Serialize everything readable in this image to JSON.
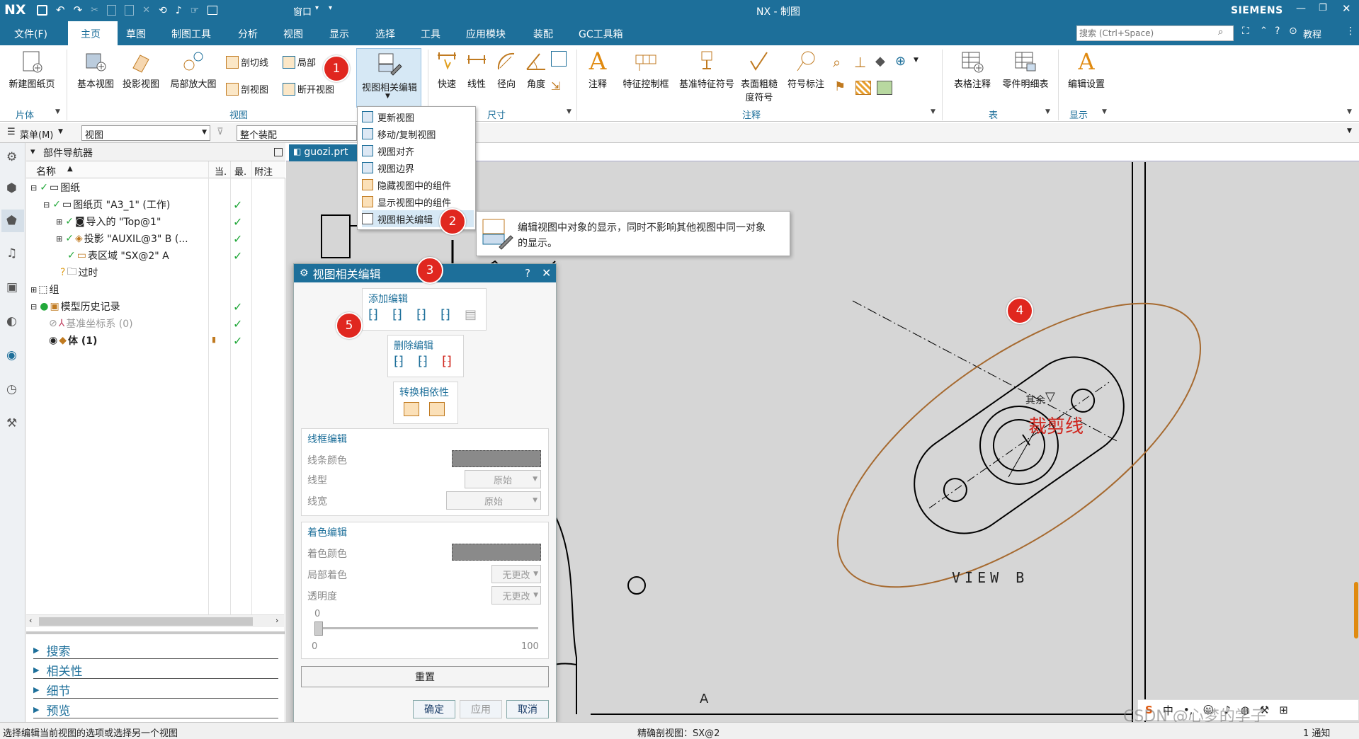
{
  "titlebar": {
    "logo": "NX",
    "title": "NX - 制图",
    "brand": "SIEMENS",
    "window_menu": "窗口",
    "quick_icons": [
      "save-icon",
      "undo-icon",
      "redo-icon",
      "cut-icon",
      "copy-icon",
      "paste-icon",
      "delete-icon",
      "repeat-icon",
      "microphone-icon",
      "touch-mode-icon",
      "switch-window-icon"
    ]
  },
  "menubar": {
    "file": "文件(F)",
    "tabs": [
      "主页",
      "草图",
      "制图工具",
      "分析",
      "视图",
      "显示",
      "选择",
      "工具",
      "应用模块",
      "装配",
      "GC工具箱"
    ],
    "active_tab": "主页",
    "search_placeholder": "搜索 (Ctrl+Space)",
    "tutorial": "教程"
  },
  "ribbon": {
    "new_sheet": "新建图纸页",
    "group_sheet": "片体",
    "base_view": "基本视图",
    "projected_view": "投影视图",
    "detail_view": "局部放大图",
    "section_line": "剖切线",
    "section_view": "剖视图",
    "local": "局部",
    "break_view": "断开视图",
    "view_dep_edit": "视图相关编辑",
    "group_view": "视图",
    "rapid": "快速",
    "linear": "线性",
    "radial": "径向",
    "angular": "角度",
    "group_dim": "尺寸",
    "note": "注释",
    "fcf": "特征控制框",
    "datum_symbol": "基准特征符号",
    "surface_finish_1": "表面粗糙",
    "surface_finish_2": "度符号",
    "id_symbol": "符号标注",
    "group_annotation": "注释",
    "tabular_note": "表格注释",
    "parts_list": "零件明细表",
    "group_table": "表",
    "edit_settings": "编辑设置",
    "group_display": "显示"
  },
  "selbar": {
    "menu": "菜单(M)",
    "filter": "视图",
    "scope": "整个装配"
  },
  "popup_menu": {
    "items": [
      "更新视图",
      "移动/复制视图",
      "视图对齐",
      "视图边界",
      "隐藏视图中的组件",
      "显示视图中的组件",
      "视图相关编辑"
    ]
  },
  "tooltip": {
    "line1": "编辑视图中对象的显示，同时不影响其他视图中同一对象",
    "line2": "的显示。"
  },
  "navigator": {
    "title": "部件导航器",
    "col_name": "名称",
    "col_current": "当.",
    "col_latest": "最.",
    "col_note": "附注",
    "rows": [
      {
        "label": "图纸",
        "check": "✓"
      },
      {
        "label": "图纸页 \"A3_1\" (工作)",
        "check": "✓"
      },
      {
        "label": "导入的 \"Top@1\"",
        "check": "✓"
      },
      {
        "label": "投影 \"AUXIL@3\" B (...",
        "check": "✓"
      },
      {
        "label": "表区域 \"SX@2\" A",
        "check": "✓"
      },
      {
        "label": "过时",
        "check": ""
      },
      {
        "label": "组",
        "check": ""
      },
      {
        "label": "模型历史记录",
        "check": "✓"
      },
      {
        "label": "基准坐标系 (0)",
        "check": "✓"
      },
      {
        "label": "体 (1)",
        "check": "✓"
      }
    ],
    "accordion": [
      "搜索",
      "相关性",
      "细节",
      "预览"
    ]
  },
  "file_tab": "guozi.prt",
  "dialog": {
    "title": "视图相关编辑",
    "add_edit": "添加编辑",
    "remove_edit": "删除编辑",
    "convert_dep": "转换相依性",
    "wire_edit": "线框编辑",
    "line_color": "线条颜色",
    "line_type": "线型",
    "line_type_val": "原始",
    "line_width": "线宽",
    "line_width_val": "原始",
    "shade_edit": "着色编辑",
    "shade_color": "着色颜色",
    "partial_shade": "局部着色",
    "partial_shade_val": "无更改",
    "transparency": "透明度",
    "transparency_val": "无更改",
    "slider_value": "0",
    "slider_min": "0",
    "slider_max": "100",
    "reset": "重置",
    "ok": "确定",
    "apply": "应用",
    "cancel": "取消"
  },
  "drawing": {
    "annotation": "裁剪线",
    "view_label": "VIEW  B",
    "rest_label": "其余",
    "section_label": "A"
  },
  "badges": [
    "1",
    "2",
    "3",
    "4",
    "5"
  ],
  "status": {
    "left": "选择编辑当前视图的选项或选择另一个视图",
    "center": "精确剖视图：SX@2",
    "notify": "1 通知"
  },
  "ime": [
    "S",
    "中",
    "•,"
  ],
  "watermark": "CSDN @心梦的学子",
  "colors": {
    "accent": "#1d6f9a",
    "badge": "#e0271f",
    "check": "#22a83a",
    "annotation": "#d0271f"
  }
}
